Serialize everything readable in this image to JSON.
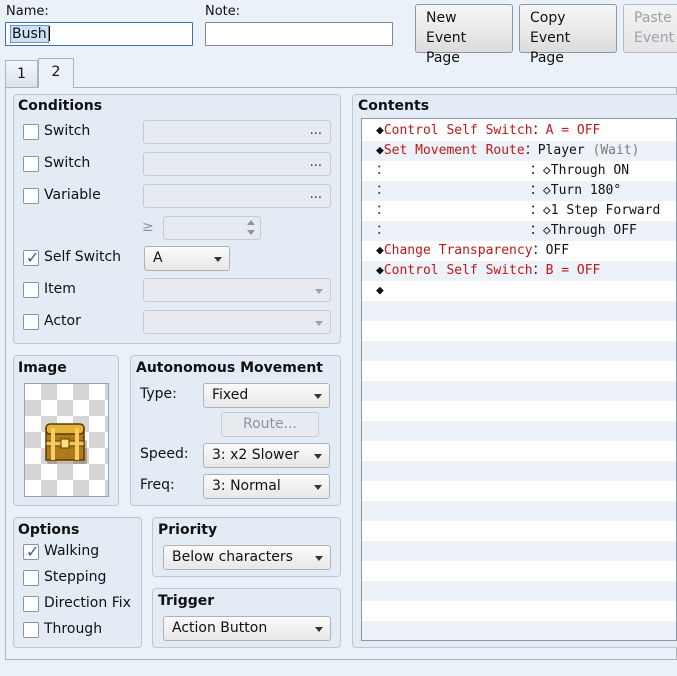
{
  "header": {
    "name_label": "Name:",
    "name_value": "Bush",
    "note_label": "Note:",
    "note_value": "",
    "new_page": [
      "New",
      "Event Page"
    ],
    "copy_page": [
      "Copy",
      "Event Page"
    ],
    "paste_page": [
      "Paste",
      "Event"
    ]
  },
  "tabs": [
    "1",
    "2"
  ],
  "active_tab": "2",
  "conditions": {
    "title": "Conditions",
    "switch1": {
      "label": "Switch",
      "checked": false
    },
    "switch2": {
      "label": "Switch",
      "checked": false
    },
    "variable": {
      "label": "Variable",
      "checked": false
    },
    "gte_symbol": "≥",
    "self_switch": {
      "label": "Self Switch",
      "checked": true,
      "value": "A"
    },
    "item": {
      "label": "Item",
      "checked": false
    },
    "actor": {
      "label": "Actor",
      "checked": false
    },
    "ellipsis": "..."
  },
  "image": {
    "title": "Image"
  },
  "autonomous": {
    "title": "Autonomous Movement",
    "type_label": "Type:",
    "type_value": "Fixed",
    "route_button": "Route...",
    "speed_label": "Speed:",
    "speed_value": "3: x2 Slower",
    "freq_label": "Freq:",
    "freq_value": "3: Normal"
  },
  "options": {
    "title": "Options",
    "walking": {
      "label": "Walking",
      "checked": true
    },
    "stepping": {
      "label": "Stepping",
      "checked": false
    },
    "direction_fix": {
      "label": "Direction Fix",
      "checked": false
    },
    "through": {
      "label": "Through",
      "checked": false
    }
  },
  "priority": {
    "title": "Priority",
    "value": "Below characters"
  },
  "trigger": {
    "title": "Trigger",
    "value": "Action Button"
  },
  "contents": {
    "title": "Contents",
    "rows": [
      {
        "pre": "◆",
        "cmd": "Control Self Switch",
        "sep": "：",
        "arg": "A = OFF",
        "cmd_red": true,
        "arg_red": true
      },
      {
        "pre": "◆",
        "cmd": "Set Movement Route",
        "sep": "：",
        "arg": "Player",
        "extra": " (Wait)",
        "cmd_red": true,
        "arg_red": false
      },
      {
        "pre": "：",
        "cmd": "                  ",
        "sep": "：",
        "arg": "◇Through ON",
        "cmd_red": false,
        "arg_red": false
      },
      {
        "pre": "：",
        "cmd": "                  ",
        "sep": "：",
        "arg": "◇Turn 180°",
        "cmd_red": false,
        "arg_red": false
      },
      {
        "pre": "：",
        "cmd": "                  ",
        "sep": "：",
        "arg": "◇1 Step Forward",
        "cmd_red": false,
        "arg_red": false
      },
      {
        "pre": "：",
        "cmd": "                  ",
        "sep": "：",
        "arg": "◇Through OFF",
        "cmd_red": false,
        "arg_red": false
      },
      {
        "pre": "◆",
        "cmd": "Change Transparency",
        "sep": "：",
        "arg": "OFF",
        "cmd_red": true,
        "arg_red": false
      },
      {
        "pre": "◆",
        "cmd": "Control Self Switch",
        "sep": "：",
        "arg": "B = OFF",
        "cmd_red": true,
        "arg_red": true
      },
      {
        "pre": "◆",
        "cmd": "",
        "sep": "",
        "arg": "",
        "cmd_red": false,
        "arg_red": false
      }
    ]
  }
}
